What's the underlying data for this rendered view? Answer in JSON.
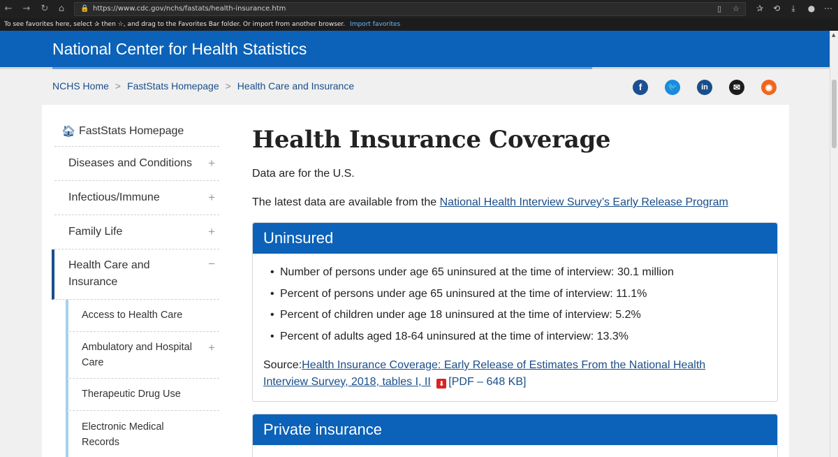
{
  "browser": {
    "url": "https://www.cdc.gov/nchs/fastats/health-insurance.htm",
    "favorites_text": "To see favorites here, select ✰ then ☆, and drag to the Favorites Bar folder. Or import from another browser.",
    "import_link": "Import favorites"
  },
  "site": {
    "title": "National Center for Health Statistics"
  },
  "breadcrumb": [
    "NCHS Home",
    "FastStats Homepage",
    "Health Care and Insurance"
  ],
  "social": [
    "facebook-icon",
    "twitter-icon",
    "linkedin-icon",
    "email-icon",
    "rss-icon"
  ],
  "leftnav": {
    "home": "FastStats Homepage",
    "items": [
      {
        "label": "Diseases and Conditions",
        "toggle": "+"
      },
      {
        "label": "Infectious/Immune",
        "toggle": "+"
      },
      {
        "label": "Family Life",
        "toggle": "+"
      },
      {
        "label_line1": "Health Care and",
        "label_line2": "Insurance",
        "toggle": "−"
      }
    ],
    "subitems": [
      {
        "label": "Access to Health Care"
      },
      {
        "label_line1": "Ambulatory and Hospital",
        "label_line2": "Care",
        "toggle": "+"
      },
      {
        "label": "Therapeutic Drug Use"
      },
      {
        "label_line1": "Electronic Medical",
        "label_line2": "Records"
      }
    ]
  },
  "main": {
    "title": "Health Insurance Coverage",
    "intro": "Data are for the U.S.",
    "latest_prefix": "The latest data are available from the",
    "latest_link": "National Health Interview Survey’s Early Release Program",
    "uninsured": {
      "heading": "Uninsured",
      "bullets": [
        "Number of persons under age 65 uninsured at the time of interview: 30.1 million",
        "Percent of persons under age 65 uninsured at the time of interview: 11.1%",
        "Percent of children under age 18 uninsured at the time of interview: 5.2%",
        "Percent of adults aged 18-64 uninsured at the time of interview: 13.3%"
      ],
      "source_label": "Source:",
      "source_link": "Health Insurance Coverage: Early Release of Estimates From the National Health Interview Survey, 2018, tables I, II",
      "pdf_label": "[PDF – 648 KB]"
    },
    "private": {
      "heading": "Private insurance"
    }
  }
}
